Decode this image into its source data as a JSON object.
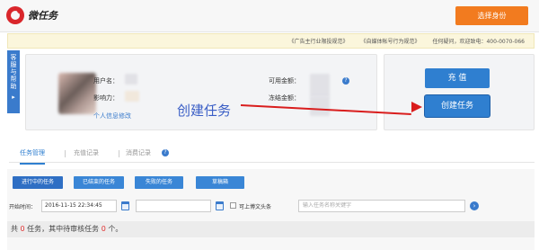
{
  "header": {
    "logo_text": "微任务",
    "role_button": "选择身份"
  },
  "notice": {
    "link1": "《广告主行业限投规范》",
    "link2": "《自媒体帐号行为规范》",
    "contact": "任何疑问，欢迎致电：400-0070-066"
  },
  "help_tab": {
    "label": "客服与帮助",
    "arrow": "▸"
  },
  "account": {
    "username_label": "用户名：",
    "influence_label": "影响力：",
    "edit_link": "个人信息修改",
    "available_label": "可用金额：",
    "frozen_label": "冻结金额：",
    "help_icon": "?"
  },
  "actions": {
    "recharge": "充 值",
    "create_task": "创建任务",
    "annotation": "创建任务"
  },
  "tabs": {
    "items": [
      "任务管理",
      "充值记录",
      "消费记录"
    ],
    "active": "任务管理",
    "help_icon": "?"
  },
  "filters": [
    "进行中的任务",
    "已结束的任务",
    "失败的任务",
    "草稿箱"
  ],
  "search_row": {
    "start_label": "开始时间：",
    "start_value": "2016-11-15 22:34:45",
    "end_value": "",
    "checkbox_label": "可上博文头条",
    "search_placeholder": "输入任务名称关键字"
  },
  "summary": {
    "prefix": "共 ",
    "total": "0",
    "mid": " 任务，其中待审核任务 ",
    "pending": "0",
    "suffix": " 个。"
  }
}
